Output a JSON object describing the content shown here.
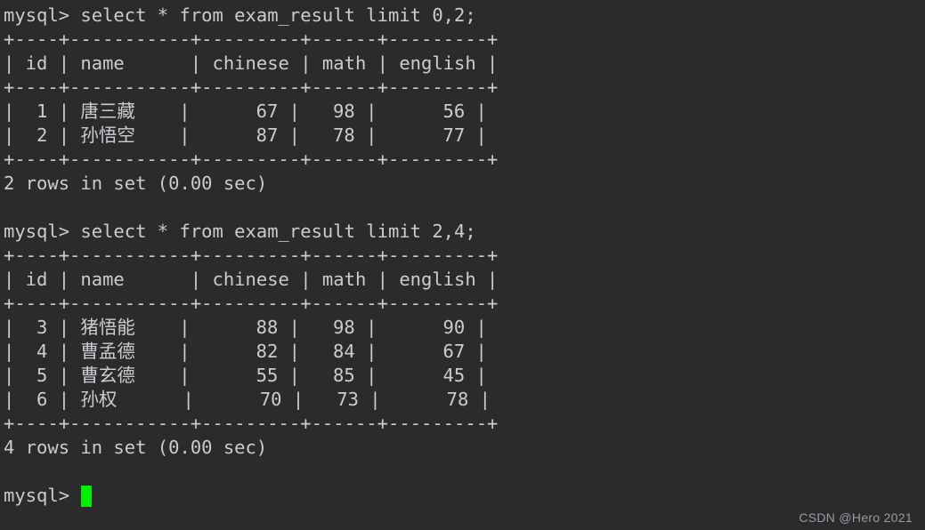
{
  "terminal": {
    "background_color": "#2b2b2d",
    "foreground_color": "#ccccd0",
    "cursor_color": "#00ee00",
    "prompt": "mysql> ",
    "blank": " "
  },
  "session": {
    "queries": [
      {
        "prompt_line": "mysql> select * from exam_result limit 0,2;",
        "table": {
          "border": "+----+-----------+---------+------+---------+",
          "header": "| id | name      | chinese | math | english |",
          "columns": [
            "id",
            "name",
            "chinese",
            "math",
            "english"
          ],
          "rows": [
            "|  1 | 唐三藏    |      67 |   98 |      56 |",
            "|  2 | 孙悟空    |      87 |   78 |      77 |"
          ],
          "row_values": [
            {
              "id": 1,
              "name": "唐三藏",
              "chinese": 67,
              "math": 98,
              "english": 56
            },
            {
              "id": 2,
              "name": "孙悟空",
              "chinese": 87,
              "math": 78,
              "english": 77
            }
          ]
        },
        "status": "2 rows in set (0.00 sec)"
      },
      {
        "prompt_line": "mysql> select * from exam_result limit 2,4;",
        "table": {
          "border": "+----+-----------+---------+------+---------+",
          "header": "| id | name      | chinese | math | english |",
          "columns": [
            "id",
            "name",
            "chinese",
            "math",
            "english"
          ],
          "rows": [
            "|  3 | 猪悟能    |      88 |   98 |      90 |",
            "|  4 | 曹孟德    |      82 |   84 |      67 |",
            "|  5 | 曹玄德    |      55 |   85 |      45 |",
            "|  6 | 孙权      |      70 |   73 |      78 |"
          ],
          "row_values": [
            {
              "id": 3,
              "name": "猪悟能",
              "chinese": 88,
              "math": 98,
              "english": 90
            },
            {
              "id": 4,
              "name": "曹孟德",
              "chinese": 82,
              "math": 84,
              "english": 67
            },
            {
              "id": 5,
              "name": "曹玄德",
              "chinese": 55,
              "math": 85,
              "english": 45
            },
            {
              "id": 6,
              "name": "孙权",
              "chinese": 70,
              "math": 73,
              "english": 78
            }
          ]
        },
        "status": "4 rows in set (0.00 sec)"
      }
    ],
    "final_prompt": "mysql> "
  },
  "watermark": {
    "text": "CSDN @Hero 2021"
  }
}
